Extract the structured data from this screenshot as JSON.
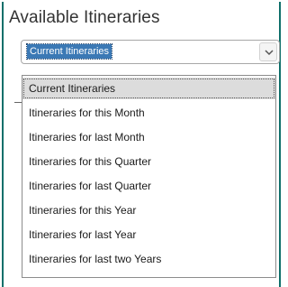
{
  "panel": {
    "title": "Available Itineraries"
  },
  "select": {
    "value": "Current Itineraries",
    "arrow_icon": "chevron-down-icon"
  },
  "dropdown": {
    "options": [
      "Current Itineraries",
      "Itineraries for this Month",
      "Itineraries for last Month",
      "Itineraries for this Quarter",
      "Itineraries for last Quarter",
      "Itineraries for this Year",
      "Itineraries for last Year",
      "Itineraries for last two Years"
    ],
    "selected_index": 0
  },
  "colors": {
    "panel_border": "#0f6f6a",
    "selection_fill": "#3b79b5",
    "highlight_row": "#dcdcdc"
  }
}
